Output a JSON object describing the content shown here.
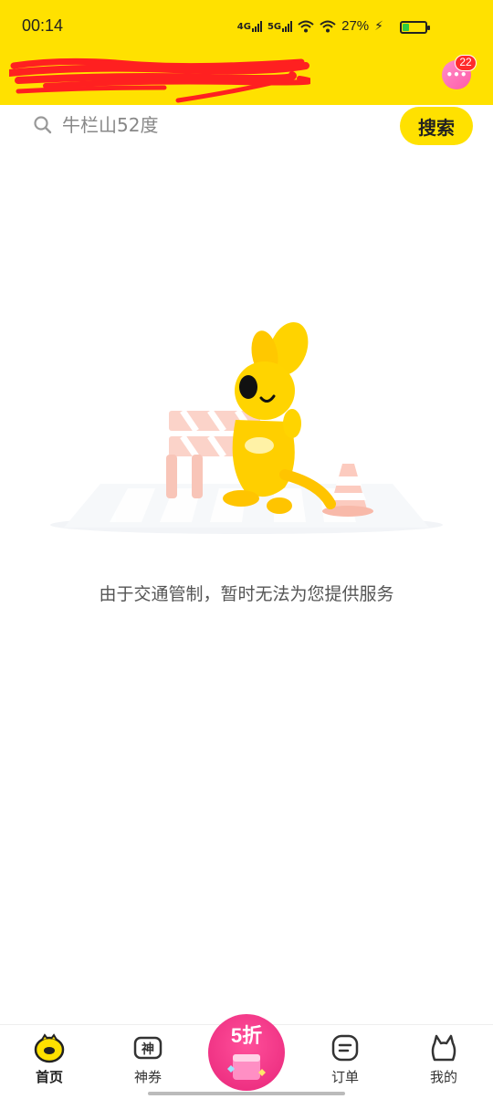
{
  "status_bar": {
    "time": "00:14",
    "network_1": "4G",
    "network_2": "5G",
    "battery_percent": "27%",
    "battery_level": 0.27
  },
  "header": {
    "location_icon": "chevron-down-icon",
    "messages_badge": "22"
  },
  "search": {
    "placeholder": "牛栏山52度",
    "button_label": "搜索"
  },
  "main": {
    "empty_message": "由于交通管制，暂时无法为您提供服务"
  },
  "bottom_nav": {
    "items": [
      {
        "label": "首页",
        "icon": "home-mascot-icon",
        "active": true
      },
      {
        "label": "神券",
        "icon": "coupon-icon",
        "active": false
      },
      {
        "label": "订单",
        "icon": "order-icon",
        "active": false
      },
      {
        "label": "我的",
        "icon": "profile-icon",
        "active": false
      }
    ],
    "promo_label": "5折"
  },
  "colors": {
    "brand_yellow": "#FFE100",
    "promo_pink": "#E8267A",
    "badge_red": "#FF2B2B"
  }
}
